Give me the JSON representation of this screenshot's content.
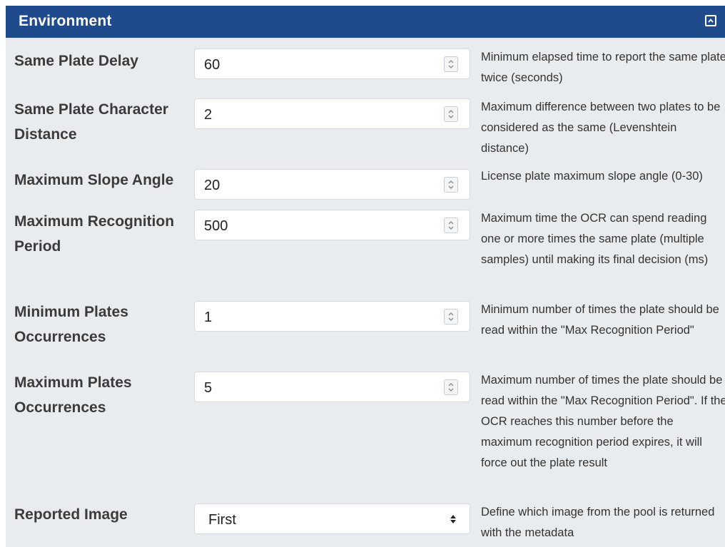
{
  "panel": {
    "title": "Environment",
    "collapse_icon": "collapse-up-icon"
  },
  "fields": [
    {
      "label": "Same Plate Delay",
      "value": "60",
      "control": "number",
      "description": "Minimum elapsed time to report the same plate twice (seconds)"
    },
    {
      "label": "Same Plate Character Distance",
      "value": "2",
      "control": "number",
      "description": "Maximum difference between two plates to be considered as the same (Levenshtein distance)"
    },
    {
      "label": "Maximum Slope Angle",
      "value": "20",
      "control": "number",
      "description": "License plate maximum slope angle (0-30)"
    },
    {
      "label": "Maximum Recognition Period",
      "value": "500",
      "control": "number",
      "description": "Maximum time the OCR can spend reading one or more times the same plate (multiple samples) until making its final decision (ms)"
    },
    {
      "label": "Minimum Plates Occurrences",
      "value": "1",
      "control": "number",
      "description": "Minimum number of times the plate should be read within the \"Max Recognition Period\""
    },
    {
      "label": "Maximum Plates Occurrences",
      "value": "5",
      "control": "number",
      "description": "Maximum number of times the plate should be read within the \"Max Recognition Period\". If the OCR reaches this number before the maximum recognition period expires, it will force out the plate result"
    },
    {
      "label": "Reported Image",
      "value": "First",
      "control": "select",
      "description": "Define which image from the pool is returned with the metadata"
    }
  ]
}
